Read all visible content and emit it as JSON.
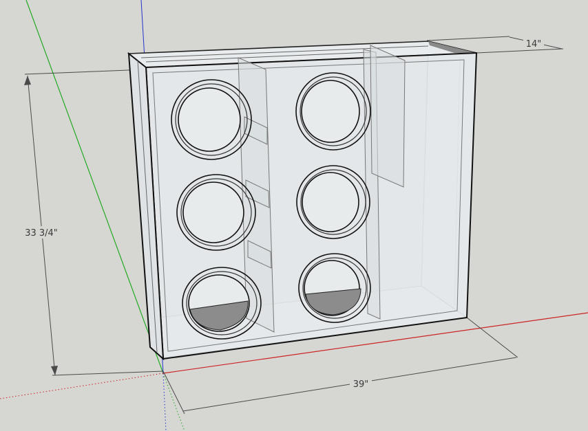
{
  "scene": {
    "background_color": "#d6d6d2",
    "axis_colors": {
      "red": "#cc2222",
      "green": "#22aa22",
      "blue": "#2233cc"
    },
    "model_fill": "#e4e8ea",
    "port_fill": "#8c8c8c"
  },
  "dimensions": {
    "depth": "14\"",
    "height": "33 3/4\"",
    "width": "39\""
  }
}
